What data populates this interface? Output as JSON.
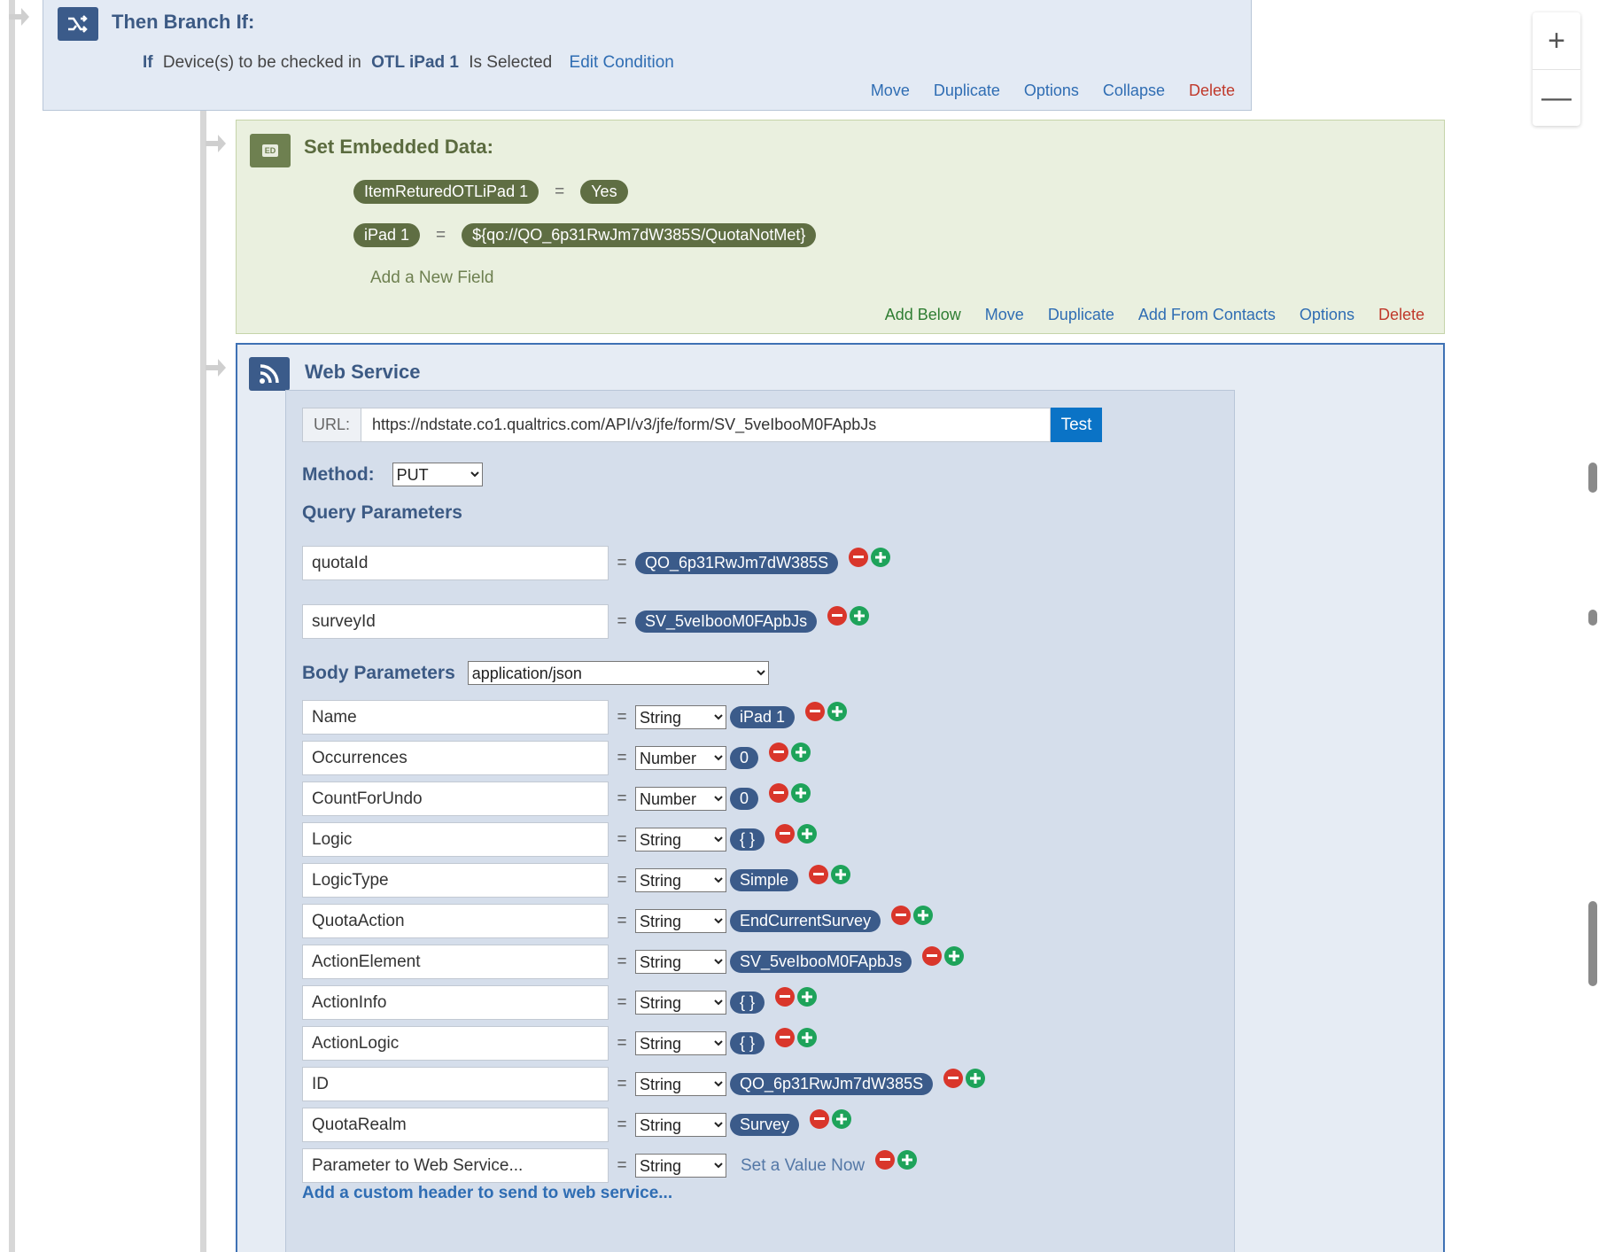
{
  "branch": {
    "title": "Then Branch If:",
    "cond_if": "If",
    "cond_text": "Device(s) to be checked in",
    "cond_value": "OTL iPad 1",
    "cond_state": "Is Selected",
    "edit_link": "Edit Condition",
    "actions": {
      "move": "Move",
      "duplicate": "Duplicate",
      "options": "Options",
      "collapse": "Collapse",
      "delete": "Delete"
    }
  },
  "embedded_data": {
    "title": "Set Embedded Data:",
    "icon_label": "ED",
    "rows": [
      {
        "key": "ItemReturedOTLiPad 1",
        "value": "Yes"
      },
      {
        "key": "iPad 1",
        "value": "${qo://QO_6p31RwJm7dW385S/QuotaNotMet}"
      }
    ],
    "equals": "=",
    "add_field": "Add a New Field",
    "actions": {
      "add_below": "Add Below",
      "move": "Move",
      "duplicate": "Duplicate",
      "add_from_contacts": "Add From Contacts",
      "options": "Options",
      "delete": "Delete"
    }
  },
  "web_service": {
    "title": "Web Service",
    "url_label": "URL:",
    "url_value": "https://ndstate.co1.qualtrics.com/API/v3/jfe/form/SV_5veIbooM0FApbJs",
    "test_label": "Test",
    "method_label": "Method:",
    "method_value": "PUT",
    "query_title": "Query Parameters",
    "query_params": [
      {
        "key": "quotaId",
        "value": "QO_6p31RwJm7dW385S"
      },
      {
        "key": "surveyId",
        "value": "SV_5veIbooM0FApbJs"
      }
    ],
    "body_title": "Body Parameters",
    "body_format": "application/json",
    "body_params": [
      {
        "key": "Name",
        "type": "String",
        "value": "iPad 1"
      },
      {
        "key": "Occurrences",
        "type": "Number",
        "value": "0"
      },
      {
        "key": "CountForUndo",
        "type": "Number",
        "value": "0"
      },
      {
        "key": "Logic",
        "type": "String",
        "value": "{ }"
      },
      {
        "key": "LogicType",
        "type": "String",
        "value": "Simple"
      },
      {
        "key": "QuotaAction",
        "type": "String",
        "value": "EndCurrentSurvey"
      },
      {
        "key": "ActionElement",
        "type": "String",
        "value": "SV_5veIbooM0FApbJs"
      },
      {
        "key": "ActionInfo",
        "type": "String",
        "value": "{ }"
      },
      {
        "key": "ActionLogic",
        "type": "String",
        "value": "{ }"
      },
      {
        "key": "ID",
        "type": "String",
        "value": "QO_6p31RwJm7dW385S"
      },
      {
        "key": "QuotaRealm",
        "type": "String",
        "value": "Survey"
      },
      {
        "key": "Parameter to Web Service...",
        "type": "String",
        "value": "Set a Value Now"
      }
    ],
    "custom_header": "Add a custom header to send to web service..."
  },
  "zoom": {
    "in": "+",
    "out": "—"
  },
  "colors": {
    "branch_bg": "#e3eaf4",
    "ed_bg": "#eaf0df",
    "ws_border": "#3e71b4",
    "pill_blue": "#3b5b8a",
    "pill_olive": "#5f6e43",
    "delete_red": "#c0392b"
  }
}
